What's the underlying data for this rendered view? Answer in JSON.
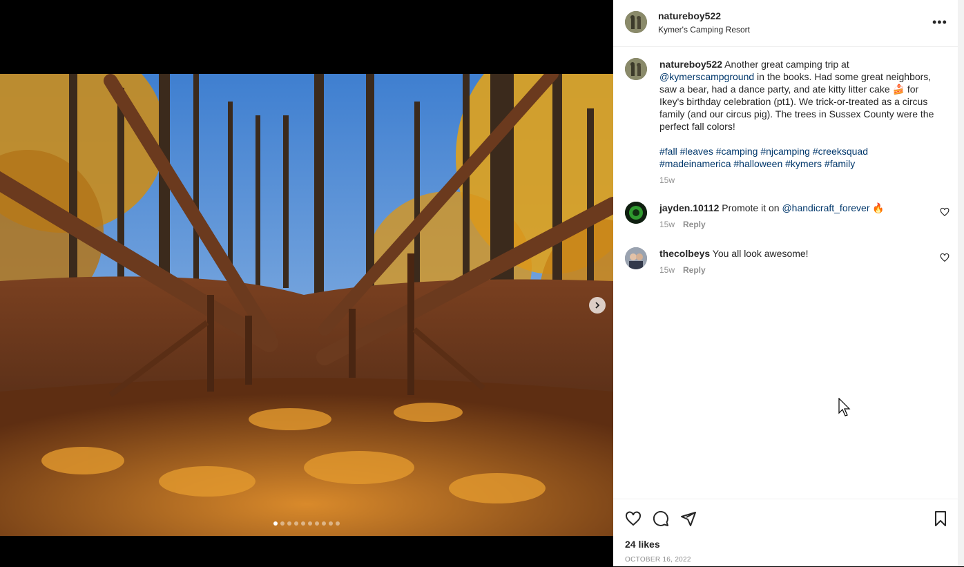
{
  "post": {
    "username": "natureboy522",
    "location": "Kymer's Camping Resort",
    "more_label": "•••",
    "caption": {
      "username": "natureboy522",
      "text_1": "Another great camping trip at",
      "mention": "@kymerscampground",
      "text_2": "in the books. Had some great neighbors, saw a bear, had a dance party, and ate kitty litter cake",
      "emoji": "🍰",
      "text_3": "for Ikey's birthday celebration (pt1). We trick-or-treated as a circus family (and our circus pig). The trees in Sussex County were the perfect fall colors!",
      "hashtags": [
        "#fall",
        "#leaves",
        "#camping",
        "#njcamping",
        "#creeksquad",
        "#madeinamerica",
        "#halloween",
        "#kymers",
        "#family"
      ],
      "time": "15w"
    },
    "comments": [
      {
        "username": "jayden.10112",
        "text": "Promote it on",
        "mention": "@handicraft_forever",
        "trail": "🔥",
        "time": "15w",
        "reply": "Reply"
      },
      {
        "username": "thecolbeys",
        "text": "You all look awesome!",
        "time": "15w",
        "reply": "Reply"
      }
    ],
    "likes": "24 likes",
    "date": "OCTOBER 16, 2022",
    "carousel": {
      "total": 10,
      "current": 1
    }
  },
  "icons": [
    "more-icon",
    "next-arrow-icon",
    "heart-icon",
    "comment-icon",
    "share-icon",
    "bookmark-icon"
  ],
  "colors": {
    "link": "#00376b",
    "muted": "#8e8e8e",
    "text": "#262626"
  }
}
